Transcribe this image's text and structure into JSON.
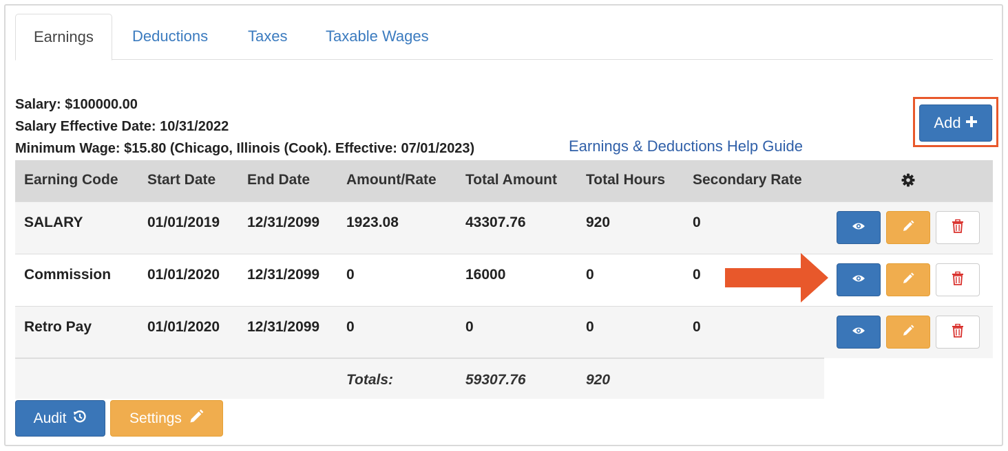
{
  "tabs": [
    {
      "label": "Earnings",
      "active": true
    },
    {
      "label": "Deductions",
      "active": false
    },
    {
      "label": "Taxes",
      "active": false
    },
    {
      "label": "Taxable Wages",
      "active": false
    }
  ],
  "info": {
    "salary": "Salary: $100000.00",
    "salary_effective_date": "Salary Effective Date: 10/31/2022",
    "minimum_wage": "Minimum Wage: $15.80 (Chicago, Illinois (Cook). Effective: 07/01/2023)",
    "help_link": "Earnings & Deductions Help Guide"
  },
  "add_button": {
    "label": "Add",
    "icon": "plus-icon"
  },
  "table": {
    "columns": [
      "Earning Code",
      "Start Date",
      "End Date",
      "Amount/Rate",
      "Total Amount",
      "Total Hours",
      "Secondary Rate"
    ],
    "settings_icon": "gear-icon",
    "rows": [
      {
        "code": "SALARY",
        "start": "01/01/2019",
        "end": "12/31/2099",
        "amount": "1923.08",
        "total": "43307.76",
        "hours": "920",
        "secondary": "0"
      },
      {
        "code": "Commission",
        "start": "01/01/2020",
        "end": "12/31/2099",
        "amount": "0",
        "total": "16000",
        "hours": "0",
        "secondary": "0"
      },
      {
        "code": "Retro Pay",
        "start": "01/01/2020",
        "end": "12/31/2099",
        "amount": "0",
        "total": "0",
        "hours": "0",
        "secondary": "0"
      }
    ],
    "row_actions": [
      "eye-icon",
      "pencil-icon",
      "trash-icon"
    ],
    "totals": {
      "label": "Totals:",
      "amount": "59307.76",
      "hours": "920"
    }
  },
  "footer": {
    "audit_label": "Audit",
    "audit_icon": "history-icon",
    "settings_label": "Settings",
    "settings_icon": "pencil-icon"
  },
  "colors": {
    "primary": "#3a76b8",
    "warning": "#f0ad4e",
    "danger": "#d9302c",
    "highlight": "#e8582b",
    "link": "#3b7bbf"
  }
}
